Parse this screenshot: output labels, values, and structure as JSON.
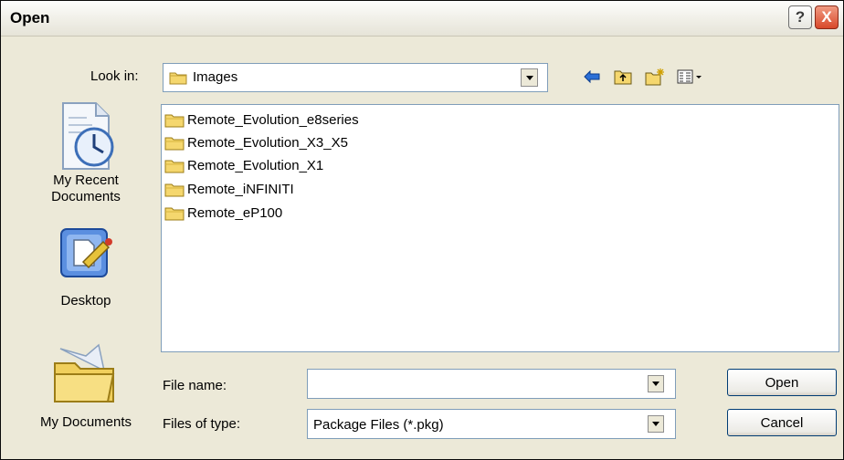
{
  "window": {
    "title": "Open"
  },
  "titlebar_buttons": {
    "help": "?",
    "close": "X"
  },
  "lookin": {
    "label": "Look in:",
    "value": "Images"
  },
  "toolbar": {
    "icons": [
      "back-arrow-icon",
      "up-folder-icon",
      "new-folder-icon",
      "view-menu-icon"
    ]
  },
  "places": [
    {
      "label_line1": "My Recent",
      "label_line2": "Documents",
      "icon": "recent-documents-icon"
    },
    {
      "label_line1": "Desktop",
      "label_line2": "",
      "icon": "desktop-icon"
    },
    {
      "label_line1": "My Documents",
      "label_line2": "",
      "icon": "my-documents-icon"
    }
  ],
  "files": [
    {
      "name": "Remote_Evolution_e8series"
    },
    {
      "name": "Remote_Evolution_X3_X5"
    },
    {
      "name": "Remote_Evolution_X1"
    },
    {
      "name": "Remote_iNFINITI"
    },
    {
      "name": "Remote_eP100"
    }
  ],
  "filename": {
    "label": "File name:",
    "value": ""
  },
  "filetype": {
    "label": "Files of type:",
    "value": "Package Files (*.pkg)"
  },
  "buttons": {
    "open": "Open",
    "cancel": "Cancel"
  },
  "colors": {
    "dialog_bg": "#ece9d8",
    "folder": "#f5d76e",
    "close_button": "#d8482a"
  }
}
